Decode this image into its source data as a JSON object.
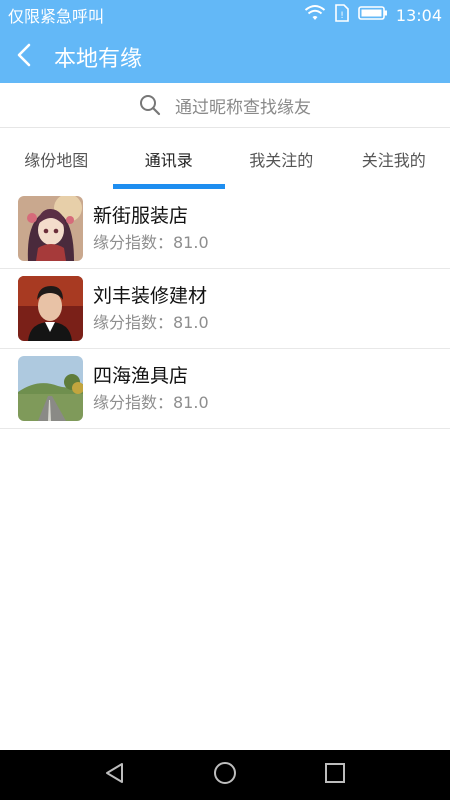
{
  "status_bar": {
    "carrier_text": "仅限紧急呼叫",
    "time": "13:04",
    "icons": [
      "wifi-icon",
      "sim-icon",
      "battery-icon"
    ]
  },
  "app_bar": {
    "title": "本地有缘",
    "back_icon": "back-arrow-icon"
  },
  "search": {
    "placeholder": "通过昵称查找缘友",
    "icon": "search-icon"
  },
  "tabs": [
    {
      "label": "缘份地图",
      "active": false
    },
    {
      "label": "通讯录",
      "active": true
    },
    {
      "label": "我关注的",
      "active": false
    },
    {
      "label": "关注我的",
      "active": false
    }
  ],
  "list": [
    {
      "name": "新街服装店",
      "sub": "缘分指数：81.0",
      "avatar": "anime-girl-avatar"
    },
    {
      "name": "刘丰装修建材",
      "sub": "缘分指数：81.0",
      "avatar": "man-portrait-avatar"
    },
    {
      "name": "四海渔具店",
      "sub": "缘分指数：81.0",
      "avatar": "road-landscape-avatar"
    }
  ],
  "nav_bar": {
    "icons": [
      "back-triangle-icon",
      "home-circle-icon",
      "recents-square-icon"
    ]
  },
  "colors": {
    "primary": "#63b8f7",
    "tab_indicator": "#1e8ef0",
    "nav_bar": "#000000"
  }
}
